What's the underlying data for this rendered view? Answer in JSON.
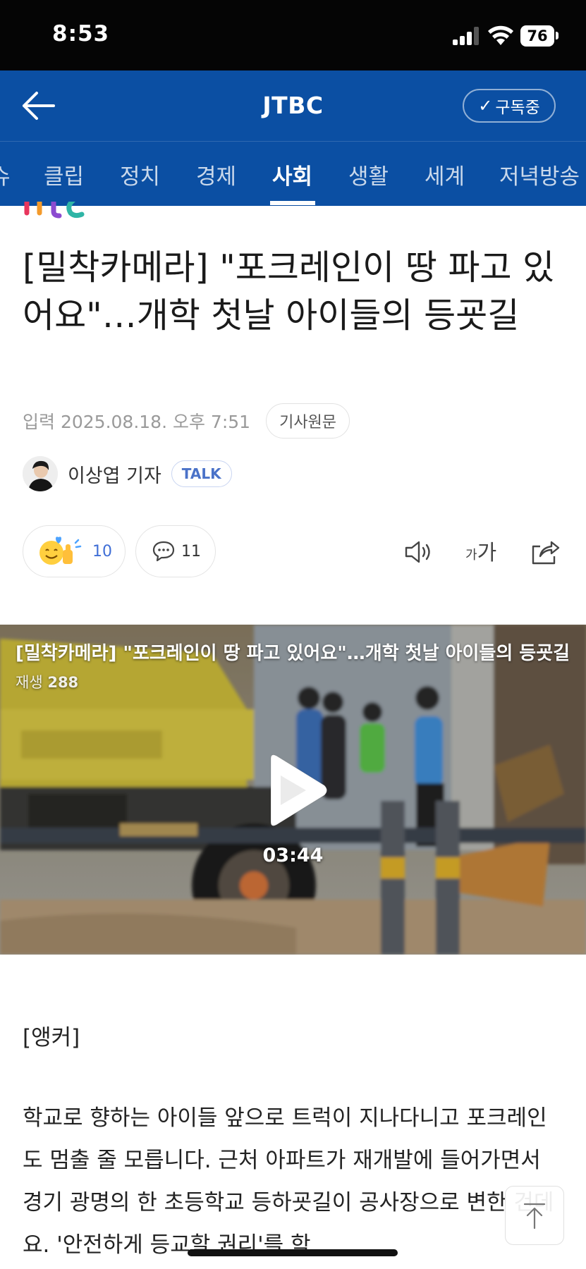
{
  "status_bar": {
    "time": "8:53",
    "battery": "76"
  },
  "header": {
    "title": "JTBC",
    "subscribe_label": "구독중"
  },
  "categories": [
    "슈",
    "클립",
    "정치",
    "경제",
    "사회",
    "생활",
    "세계",
    "저녁방송"
  ],
  "active_category": "사회",
  "article": {
    "headline": "[밀착카메라] \"포크레인이 땅 파고 있어요\"…개학 첫날 아이들의 등굣길",
    "date": "입력 2025.08.18. 오후 7:51",
    "origin_label": "기사원문",
    "reporter": "이상엽 기자",
    "talk_label": "TALK",
    "reaction_count": "10",
    "comment_count": "11",
    "font_size_small": "가",
    "font_size_big": "가"
  },
  "video": {
    "title": "[밀착카메라] \"포크레인이 땅 파고 있어요\"…개학 첫날 아이들의 등굣길",
    "views_label": "재생",
    "views_count": "288",
    "duration": "03:44"
  },
  "body": {
    "anchor_label": "[앵커]",
    "text": "학교로 향하는 아이들 앞으로 트럭이 지나다니고 포크레인도 멈출 줄 모릅니다. 근처 아파트가 재개발에 들어가면서 경기 광명의 한 초등학교 등하굣길이 공사장으로 변한 건데요. '안전하게 등교할 권리'를 학"
  },
  "colors": {
    "brand_blue": "#0b4fa3",
    "link_blue": "#3f6ed6"
  }
}
